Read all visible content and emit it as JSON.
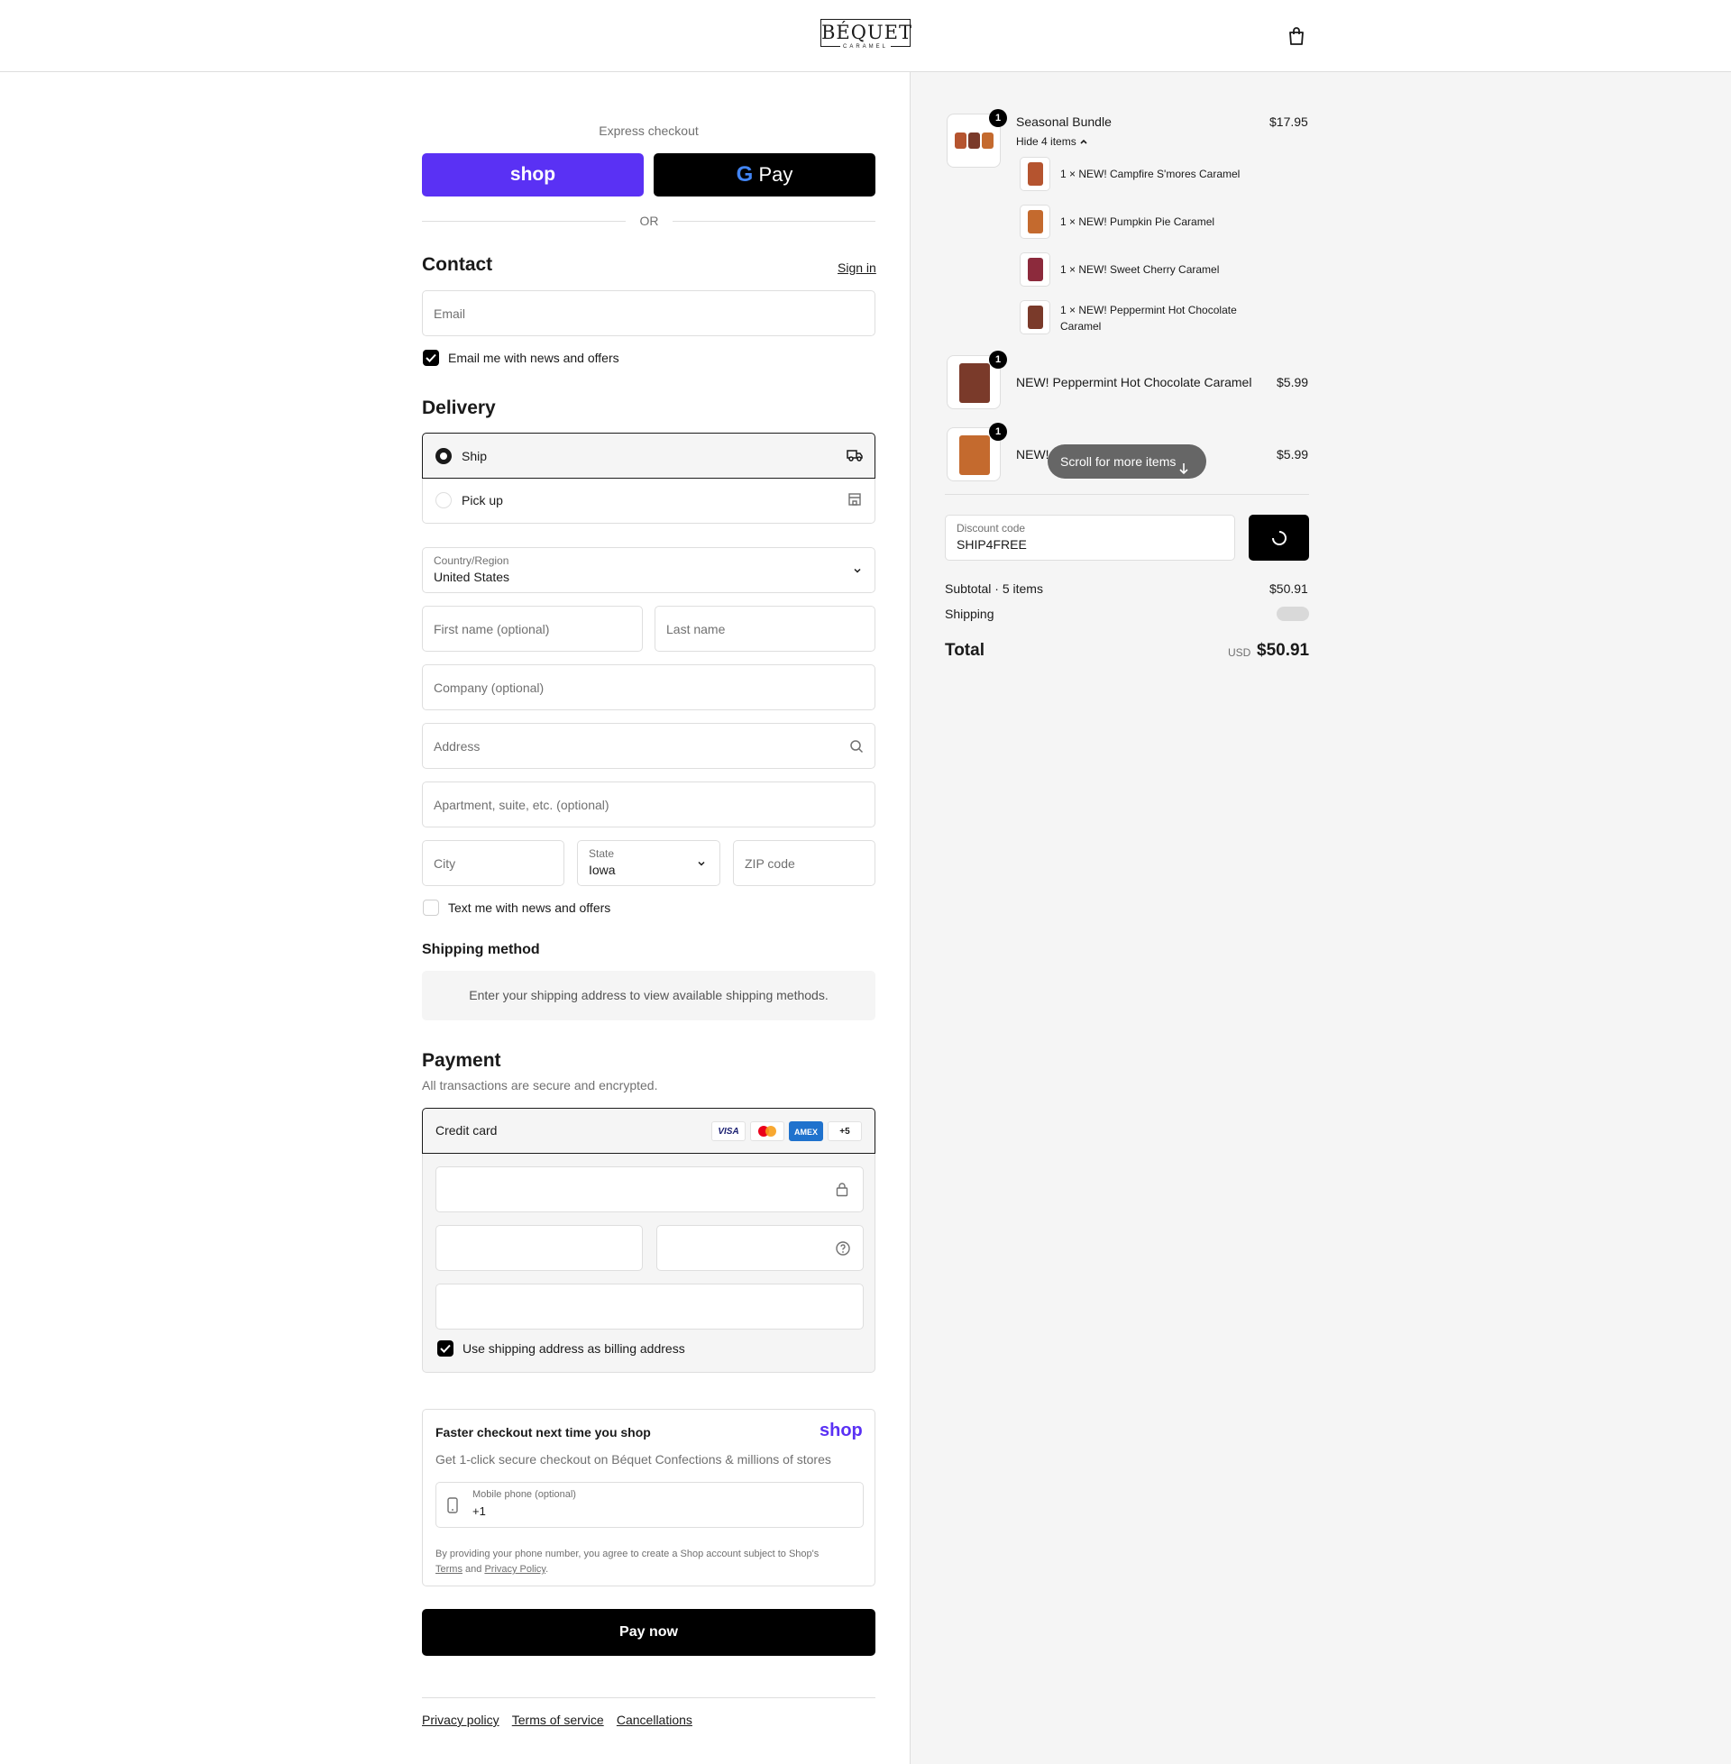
{
  "header": {
    "logo_text": "BÉQUET",
    "logo_sub": "CARAMEL",
    "cart_icon": "shopping-bag-icon"
  },
  "express": {
    "label": "Express checkout",
    "shop_label": "shop",
    "gpay_label": "Pay",
    "or": "OR"
  },
  "contact": {
    "title": "Contact",
    "sign_in": "Sign in",
    "email_placeholder": "Email",
    "news_label": "Email me with news and offers",
    "news_checked": true
  },
  "delivery": {
    "title": "Delivery",
    "options": [
      {
        "label": "Ship",
        "selected": true,
        "icon": "truck-icon"
      },
      {
        "label": "Pick up",
        "selected": false,
        "icon": "store-icon"
      }
    ],
    "country_label": "Country/Region",
    "country_value": "United States",
    "first_name_placeholder": "First name (optional)",
    "last_name_placeholder": "Last name",
    "company_placeholder": "Company (optional)",
    "address_placeholder": "Address",
    "apartment_placeholder": "Apartment, suite, etc. (optional)",
    "city_placeholder": "City",
    "state_label": "State",
    "state_value": "Iowa",
    "zip_placeholder": "ZIP code",
    "text_label": "Text me with news and offers",
    "text_checked": false
  },
  "shipping_method": {
    "title": "Shipping method",
    "note": "Enter your shipping address to view available shipping methods."
  },
  "payment": {
    "title": "Payment",
    "subtitle": "All transactions are secure and encrypted.",
    "credit_card_label": "Credit card",
    "cards": [
      "VISA",
      "mastercard",
      "AMEX",
      "+5"
    ],
    "billing_label": "Use shipping address as billing address",
    "billing_checked": true
  },
  "shop_pay": {
    "title": "Faster checkout next time you shop",
    "logo": "shop",
    "desc": "Get 1-click secure checkout on Béquet Confections & millions of stores",
    "phone_label": "Mobile phone (optional)",
    "phone_value": "+1",
    "legal_pre": "By providing your phone number, you agree to create a Shop account subject to Shop's",
    "terms": "Terms",
    "and": "and",
    "privacy": "Privacy Policy",
    "period": "."
  },
  "pay_now": "Pay now",
  "footer": {
    "links": [
      "Privacy policy",
      "Terms of service",
      "Cancellations"
    ]
  },
  "summary": {
    "items": [
      {
        "name": "Seasonal Bundle",
        "price": "$17.95",
        "qty": "1",
        "toggle": "Hide 4 items",
        "sub_items": [
          {
            "label": "1 × NEW! Campfire S'mores Caramel"
          },
          {
            "label": "1 × NEW! Pumpkin Pie Caramel"
          },
          {
            "label": "1 × NEW! Sweet Cherry Caramel"
          },
          {
            "label": "1 × NEW! Peppermint Hot Chocolate Caramel"
          }
        ]
      },
      {
        "name": "NEW! Peppermint Hot Chocolate Caramel",
        "price": "$5.99",
        "qty": "1"
      },
      {
        "name": "NEW!",
        "price": "$5.99",
        "qty": "1"
      }
    ],
    "scroll_pill": "Scroll for more items",
    "discount_label": "Discount code",
    "discount_value": "SHIP4FREE",
    "subtotal_label": "Subtotal · 5 items",
    "subtotal_value": "$50.91",
    "shipping_label": "Shipping",
    "total_label": "Total",
    "currency": "USD",
    "total_value": "$50.91"
  }
}
